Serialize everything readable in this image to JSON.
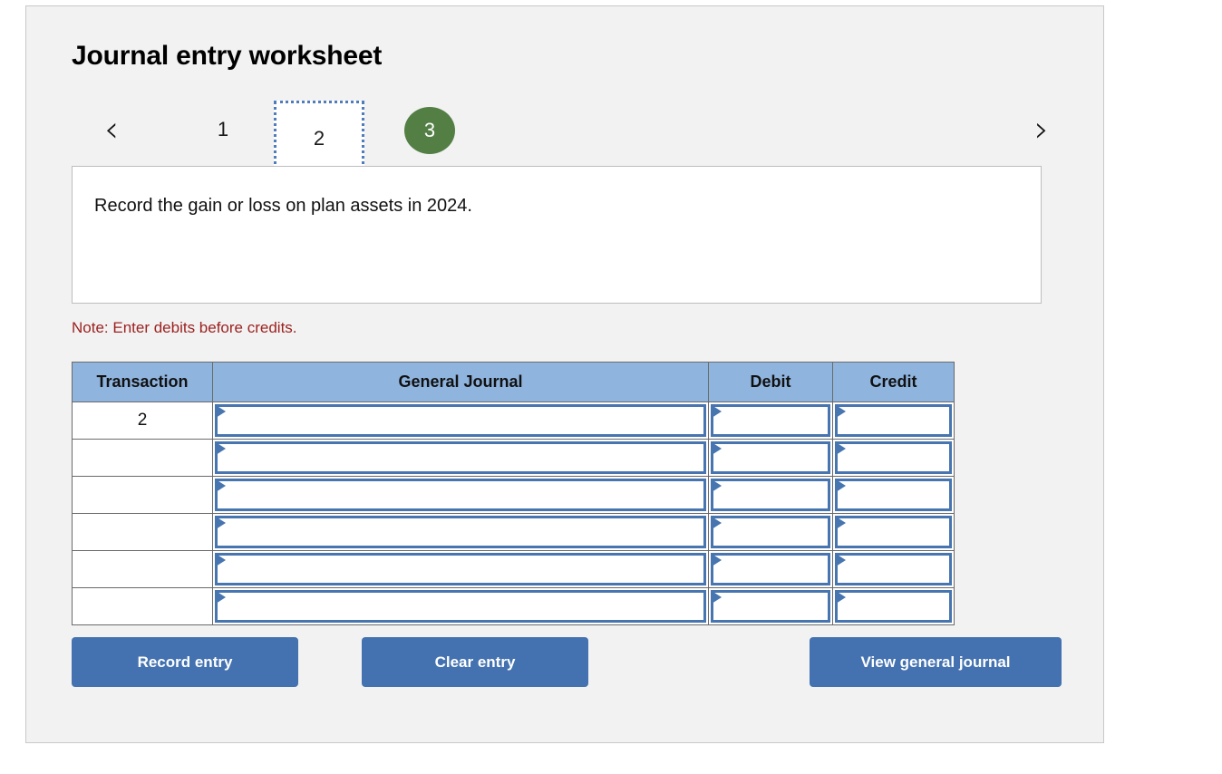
{
  "card": {
    "title": "Journal entry worksheet"
  },
  "pager": {
    "prev_icon": "chevron-left-icon",
    "next_icon": "chevron-right-icon",
    "prev_glyph": "‹",
    "next_glyph": "›",
    "steps": [
      {
        "label": "1",
        "state": "inactive"
      },
      {
        "label": "2",
        "state": "selected"
      },
      {
        "label": "3",
        "state": "completed"
      }
    ],
    "completed_color": "#537f45",
    "selected_border_color": "#4f7cba"
  },
  "instruction": {
    "text": "Record the gain or loss on plan assets in 2024."
  },
  "note": {
    "text": "Note: Enter debits before credits.",
    "color": "#9c2220"
  },
  "table": {
    "header_color": "#8fb4de",
    "columns": [
      "Transaction",
      "General Journal",
      "Debit",
      "Credit"
    ],
    "rows": [
      {
        "transaction": "2",
        "general_journal": "",
        "debit": "",
        "credit": ""
      },
      {
        "transaction": "",
        "general_journal": "",
        "debit": "",
        "credit": ""
      },
      {
        "transaction": "",
        "general_journal": "",
        "debit": "",
        "credit": ""
      },
      {
        "transaction": "",
        "general_journal": "",
        "debit": "",
        "credit": ""
      },
      {
        "transaction": "",
        "general_journal": "",
        "debit": "",
        "credit": ""
      },
      {
        "transaction": "",
        "general_journal": "",
        "debit": "",
        "credit": ""
      }
    ]
  },
  "buttons": {
    "record": "Record entry",
    "clear": "Clear entry",
    "view": "View general journal",
    "color": "#4472b0"
  }
}
